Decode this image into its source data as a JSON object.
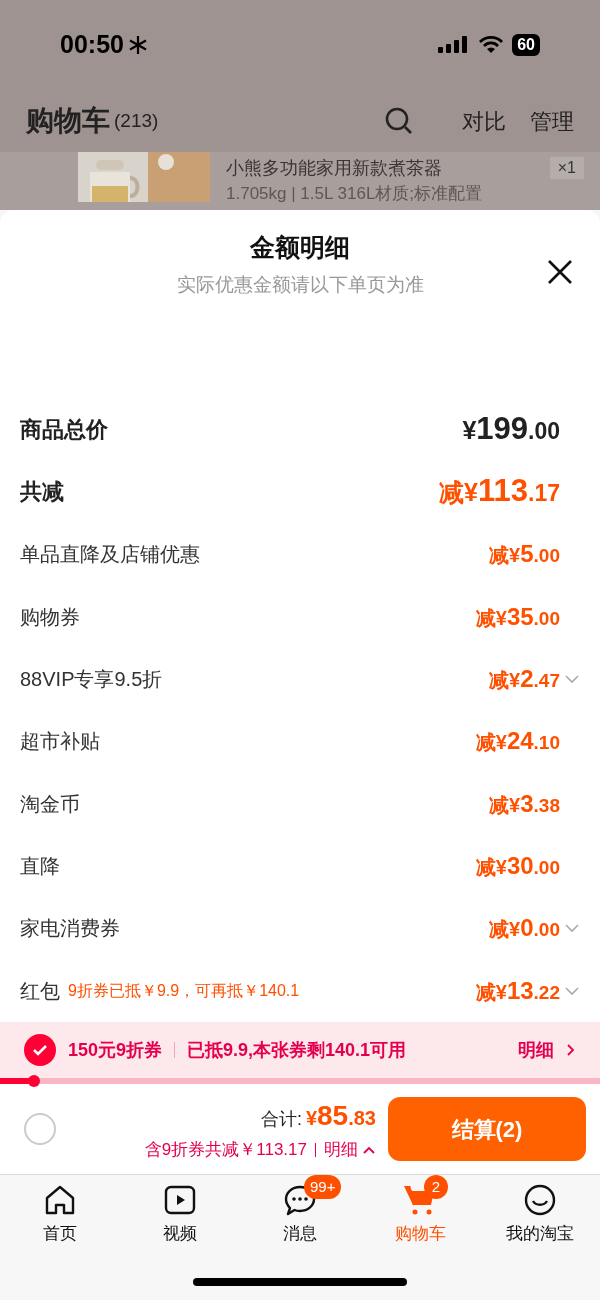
{
  "status_bar": {
    "time": "00:50",
    "battery": "60"
  },
  "header": {
    "title": "购物车",
    "count": "(213)",
    "actions": [
      "对比",
      "管理"
    ]
  },
  "product": {
    "kind": "picture",
    "title": "小熊多功能家用新款煮茶器",
    "quantity": "×1",
    "spec": "1.705kg | 1.5L 316L材质;标准配置"
  },
  "sheet": {
    "title": "金额明细",
    "subtitle": "实际优惠金额请以下单页为准",
    "rows": [
      {
        "kind": "total",
        "label": "商品总价",
        "prefix": "¥",
        "int": "199",
        "dec": ".00",
        "expandable": false
      },
      {
        "kind": "total_discount",
        "label": "共减",
        "prefix": "减¥",
        "int": "113",
        "dec": ".17",
        "expandable": false
      },
      {
        "kind": "discount",
        "label": "单品直降及店铺优惠",
        "prefix": "减¥",
        "int": "5",
        "dec": ".00",
        "expandable": false
      },
      {
        "kind": "discount",
        "label": "购物券",
        "prefix": "减¥",
        "int": "35",
        "dec": ".00",
        "expandable": false
      },
      {
        "kind": "discount",
        "label": "88VIP专享9.5折",
        "prefix": "减¥",
        "int": "2",
        "dec": ".47",
        "expandable": true
      },
      {
        "kind": "discount",
        "label": "超市补贴",
        "prefix": "减¥",
        "int": "24",
        "dec": ".10",
        "expandable": false
      },
      {
        "kind": "discount",
        "label": "淘金币",
        "prefix": "减¥",
        "int": "3",
        "dec": ".38",
        "expandable": false
      },
      {
        "kind": "discount",
        "label": "直降",
        "prefix": "减¥",
        "int": "30",
        "dec": ".00",
        "expandable": false
      },
      {
        "kind": "discount",
        "label": "家电消费券",
        "prefix": "减¥",
        "int": "0",
        "dec": ".00",
        "expandable": true
      },
      {
        "kind": "discount",
        "label": "红包",
        "note": "9折券已抵￥9.9，可再抵￥140.1",
        "prefix": "减¥",
        "int": "13",
        "dec": ".22",
        "expandable": true
      }
    ]
  },
  "coupon": {
    "checked": true,
    "name": "150元9折券",
    "info": "已抵9.9,本张券剩140.1可用",
    "link": "明细"
  },
  "checkout_bar": {
    "select_all": false,
    "total_label": "合计:",
    "total_prefix": "¥",
    "total_int": "85",
    "total_dec": ".83",
    "saving": "含9折券共减￥113.17",
    "detail": "明细",
    "button": "结算(2)"
  },
  "tabs": [
    {
      "kind": "home",
      "label": "首页",
      "selected": false
    },
    {
      "kind": "video",
      "label": "视频",
      "selected": false
    },
    {
      "kind": "message",
      "label": "消息",
      "badge": "99+",
      "selected": false
    },
    {
      "kind": "cart",
      "label": "购物车",
      "badge": "2",
      "selected": true
    },
    {
      "kind": "profile",
      "label": "我的淘宝",
      "selected": false
    }
  ]
}
